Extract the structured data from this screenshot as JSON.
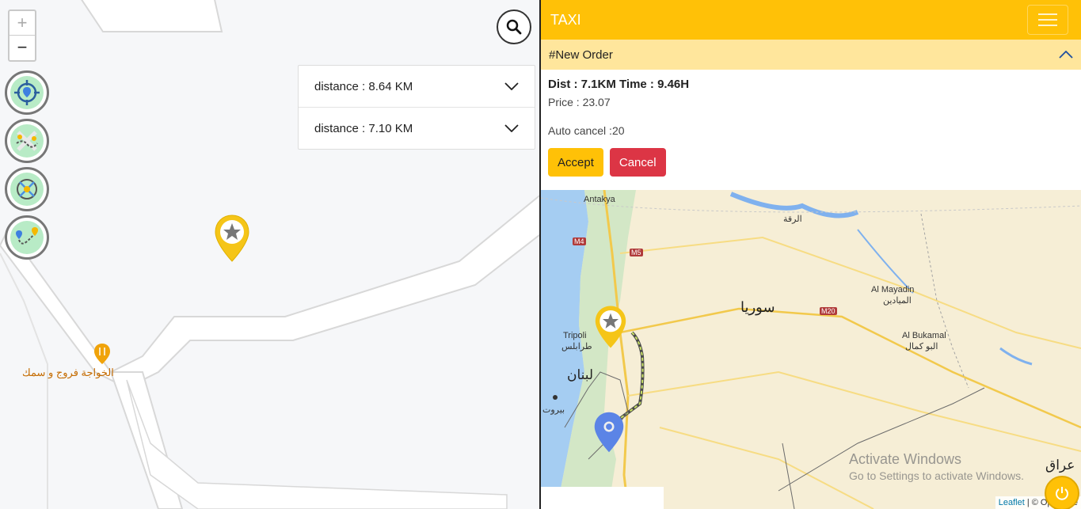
{
  "left_map": {
    "zoom_in": "+",
    "zoom_out": "−",
    "tools": [
      {
        "icon": "locate-target-icon"
      },
      {
        "icon": "route-pins-icon"
      },
      {
        "icon": "area-crosshair-icon"
      },
      {
        "icon": "path-icon"
      }
    ],
    "search_icon": "search-icon",
    "distances": [
      {
        "label": "distance : 8.64 KM"
      },
      {
        "label": "distance : 7.10 KM"
      }
    ],
    "poi_label": "الخواجة فروج و سمك",
    "marker_icon": "star-marker-icon"
  },
  "navbar": {
    "brand": "TAXI"
  },
  "order": {
    "title": "#New Order",
    "dist_time": "Dist : 7.1KM Time : 9.46H",
    "price": "Price : 23.07",
    "auto_cancel": "Auto cancel :20",
    "accept_label": "Accept",
    "cancel_label": "Cancel"
  },
  "right_map": {
    "labels": {
      "antakya": "Antakya",
      "raqqa": "الرقة",
      "syria": "سوريا",
      "mayadin": "Al Mayadin",
      "mayadin_ar": "الميادين",
      "bukamal": "Al Bukamal",
      "bukamal_ar": "البو كمال",
      "tripoli": "Tripoli",
      "tripoli_ar": "طرابلس",
      "lebanon": "لبنان",
      "beirut": "بيروت",
      "iraq": "عراق",
      "m4": "M4",
      "m5": "M5",
      "m20": "M20"
    },
    "attribution_leaflet": "Leaflet",
    "attribution_rest": " | © OpenStre",
    "watermark_line1": "Activate Windows",
    "watermark_line2": "Go to Settings to activate Windows."
  },
  "colors": {
    "accent": "#ffc107",
    "order_header": "#ffe69c",
    "cancel": "#dc3545",
    "tool_fill": "#b8ebc6"
  }
}
